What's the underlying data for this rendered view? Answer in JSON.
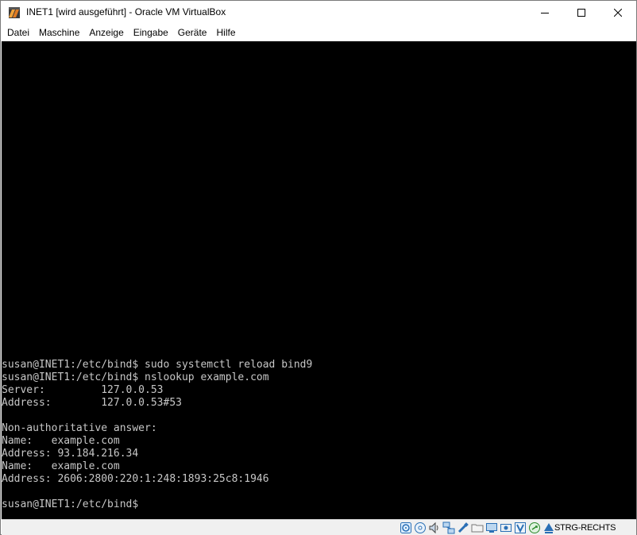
{
  "window": {
    "title": "INET1 [wird ausgeführt] - Oracle VM VirtualBox",
    "controls": {
      "minimize": "minimize-icon",
      "maximize": "maximize-icon",
      "close": "close-icon"
    }
  },
  "menu": {
    "items": [
      "Datei",
      "Maschine",
      "Anzeige",
      "Eingabe",
      "Geräte",
      "Hilfe"
    ]
  },
  "console": {
    "background": "#000000",
    "foreground": "#c7c7c7",
    "lines": [
      "susan@INET1:/etc/bind$ sudo systemctl reload bind9",
      "susan@INET1:/etc/bind$ nslookup example.com",
      "Server:         127.0.0.53",
      "Address:        127.0.0.53#53",
      "",
      "Non-authoritative answer:",
      "Name:   example.com",
      "Address: 93.184.216.34",
      "Name:   example.com",
      "Address: 2606:2800:220:1:248:1893:25c8:1946",
      "",
      "susan@INET1:/etc/bind$"
    ]
  },
  "statusbar": {
    "icons": [
      "hard-disk-icon",
      "optical-drive-icon",
      "audio-icon",
      "network-icon",
      "usb-icon",
      "shared-folders-icon",
      "display-icon",
      "recording-icon",
      "virtualization-icon",
      "mouse-integration-icon",
      "keyboard-icon"
    ],
    "host_key": "STRG-RECHTS"
  }
}
